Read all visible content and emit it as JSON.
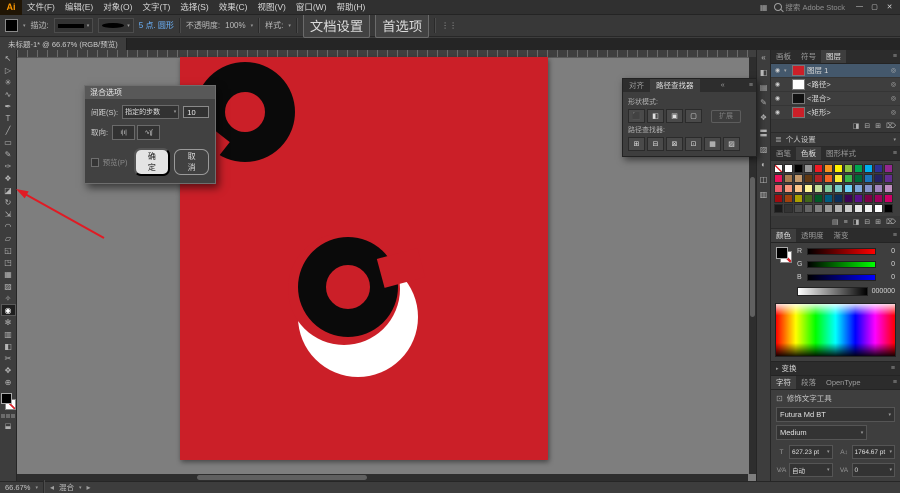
{
  "colors": {
    "artboard_red": "#cb1f28",
    "annotation_red": "#e01b24"
  },
  "menubar": {
    "logo": "Ai",
    "items": [
      "文件(F)",
      "编辑(E)",
      "对象(O)",
      "文字(T)",
      "选择(S)",
      "效果(C)",
      "视图(V)",
      "窗口(W)",
      "帮助(H)"
    ],
    "search_label": "搜索 Adobe Stock",
    "window_controls": [
      {
        "name": "minimize-button",
        "glyph": "—"
      },
      {
        "name": "maximize-button",
        "glyph": "▢"
      },
      {
        "name": "close-button",
        "glyph": "✕"
      }
    ]
  },
  "controlbar": {
    "stroke_label": "描边:",
    "brush_name": "5 点. 圆形",
    "opacity_label": "不透明度:",
    "opacity_value": "100%",
    "style_label": "样式:",
    "doc_setup_button": "文档设置",
    "preferences_button": "首选项"
  },
  "docbar": {
    "tab": "未标题-1* @ 66.67% (RGB/预览)"
  },
  "toolbar": {
    "tools": [
      {
        "name": "selection-tool",
        "glyph": "↖"
      },
      {
        "name": "direct-selection-tool",
        "glyph": "▷"
      },
      {
        "name": "magic-wand-tool",
        "glyph": "✳"
      },
      {
        "name": "lasso-tool",
        "glyph": "∿"
      },
      {
        "name": "pen-tool",
        "glyph": "✒"
      },
      {
        "name": "type-tool",
        "glyph": "T"
      },
      {
        "name": "line-segment-tool",
        "glyph": "╱"
      },
      {
        "name": "rectangle-tool",
        "glyph": "▭"
      },
      {
        "name": "paintbrush-tool",
        "glyph": "✎"
      },
      {
        "name": "pencil-tool",
        "glyph": "✑"
      },
      {
        "name": "shaper-tool",
        "glyph": "❖"
      },
      {
        "name": "eraser-tool",
        "glyph": "◪"
      },
      {
        "name": "rotate-tool",
        "glyph": "↻"
      },
      {
        "name": "scale-tool",
        "glyph": "⇲"
      },
      {
        "name": "width-tool",
        "glyph": "◠"
      },
      {
        "name": "free-transform-tool",
        "glyph": "▱"
      },
      {
        "name": "shape-builder-tool",
        "glyph": "◱"
      },
      {
        "name": "perspective-grid-tool",
        "glyph": "◳"
      },
      {
        "name": "mesh-tool",
        "glyph": "▦"
      },
      {
        "name": "gradient-tool",
        "glyph": "▨"
      },
      {
        "name": "eyedropper-tool",
        "glyph": "✧"
      },
      {
        "name": "blend-tool",
        "glyph": "◉",
        "active": true
      },
      {
        "name": "symbol-sprayer-tool",
        "glyph": "✻"
      },
      {
        "name": "column-graph-tool",
        "glyph": "▥"
      },
      {
        "name": "artboard-tool",
        "glyph": "◧"
      },
      {
        "name": "slice-tool",
        "glyph": "✂"
      },
      {
        "name": "hand-tool",
        "glyph": "✥"
      },
      {
        "name": "zoom-tool",
        "glyph": "⊕"
      }
    ]
  },
  "dialog": {
    "title": "混合选项",
    "spacing_label": "间距(S):",
    "spacing_value": "指定的步数",
    "steps_value": "10",
    "orientation_label": "取向:",
    "orientation_icons": [
      {
        "name": "align-to-page-button",
        "glyph": "ı|ı|"
      },
      {
        "name": "align-to-path-button",
        "glyph": "∿ʅʃ"
      }
    ],
    "preview_label": "预览(P)",
    "ok_label": "确定",
    "cancel_label": "取消"
  },
  "pathfinder_panel": {
    "tabs": [
      {
        "label": "对齐"
      },
      {
        "label": "路径查找器",
        "active": true
      }
    ],
    "shape_modes_label": "形状模式:",
    "shape_mode_icons": [
      {
        "name": "unite-icon",
        "glyph": "⬛"
      },
      {
        "name": "minus-front-icon",
        "glyph": "◧"
      },
      {
        "name": "intersect-icon",
        "glyph": "▣"
      },
      {
        "name": "exclude-icon",
        "glyph": "▢"
      }
    ],
    "expand_button": "扩展",
    "pathfinder_label": "路径查找器:",
    "pathfinder_icons": [
      {
        "name": "divide-icon",
        "glyph": "⊞"
      },
      {
        "name": "trim-icon",
        "glyph": "⊟"
      },
      {
        "name": "merge-icon",
        "glyph": "⊠"
      },
      {
        "name": "crop-icon",
        "glyph": "⊡"
      },
      {
        "name": "outline-icon",
        "glyph": "▦"
      },
      {
        "name": "minus-back-icon",
        "glyph": "▨"
      }
    ]
  },
  "dock_icons": [
    {
      "name": "collapse-panels-icon",
      "glyph": "«"
    },
    {
      "name": "color-panel-icon",
      "glyph": "◧"
    },
    {
      "name": "swatches-panel-icon",
      "glyph": "▤"
    },
    {
      "name": "brushes-panel-icon",
      "glyph": "✎"
    },
    {
      "name": "symbols-panel-icon",
      "glyph": "❖"
    },
    {
      "name": "stroke-panel-icon",
      "glyph": "〓"
    },
    {
      "name": "gradient-panel-icon",
      "glyph": "▨"
    },
    {
      "name": "transparency-panel-icon",
      "glyph": "◐"
    },
    {
      "name": "appearance-panel-icon",
      "glyph": "◫"
    },
    {
      "name": "graphic-styles-panel-icon",
      "glyph": "▥"
    }
  ],
  "layers_panel": {
    "tabs": [
      {
        "label": "画板"
      },
      {
        "label": "符号"
      },
      {
        "label": "图层",
        "active": true
      }
    ],
    "rows": [
      {
        "label": "图层 1",
        "thumb": "#cb1f28",
        "selected": true,
        "expander": "▾"
      },
      {
        "label": "<路径>",
        "thumb": "#ffffff",
        "expander": ""
      },
      {
        "label": "<混合>",
        "thumb": "#111111",
        "expander": ""
      },
      {
        "label": "<矩形>",
        "thumb": "#cb1f28",
        "expander": ""
      }
    ],
    "footer_icons": [
      {
        "name": "make-mask-icon",
        "glyph": "◨"
      },
      {
        "name": "new-sublayer-icon",
        "glyph": "⊟"
      },
      {
        "name": "new-layer-icon",
        "glyph": "⊞"
      },
      {
        "name": "delete-layer-icon",
        "glyph": "⌦"
      }
    ]
  },
  "library_row": {
    "label": "个人设置"
  },
  "swatches_panel": {
    "tabs": [
      {
        "label": "画笔"
      },
      {
        "label": "色板",
        "active": true
      },
      {
        "label": "图形样式"
      }
    ],
    "swatches": [
      "none",
      "#ffffff",
      "#000000",
      "#959595",
      "#ed1c24",
      "#f7941d",
      "#fff200",
      "#8dc63f",
      "#00a651",
      "#00aeef",
      "#2e3192",
      "#92278f",
      "#ed145b",
      "#a87c4f",
      "#c49a6c",
      "#603913",
      "#b02224",
      "#f26522",
      "#f9ed32",
      "#39b54a",
      "#006838",
      "#1b75bb",
      "#262262",
      "#662d91",
      "#f05a6a",
      "#f7977a",
      "#fdc689",
      "#fff799",
      "#c4df9b",
      "#82ca9c",
      "#7accc8",
      "#6dcff6",
      "#7da7d9",
      "#8493ca",
      "#a186be",
      "#bd8cbf",
      "#9e0b0f",
      "#a0410d",
      "#aba000",
      "#406618",
      "#005826",
      "#005b7f",
      "#0b2e5a",
      "#3b0256",
      "#5c0f8b",
      "#7b0046",
      "#9e005d",
      "#cc0066",
      "#1a1a1a",
      "#333333",
      "#4d4d4d",
      "#666666",
      "#808080",
      "#999999",
      "#b3b3b3",
      "#cccccc",
      "#e6e6e6",
      "#f2f2f2",
      "#ffffff",
      "#000000"
    ],
    "footer_icons": [
      {
        "name": "swatch-libraries-icon",
        "glyph": "▤"
      },
      {
        "name": "swatch-kinds-icon",
        "glyph": "≡"
      },
      {
        "name": "swatch-options-icon",
        "glyph": "◨"
      },
      {
        "name": "new-color-group-icon",
        "glyph": "⊟"
      },
      {
        "name": "new-swatch-icon",
        "glyph": "⊞"
      },
      {
        "name": "delete-swatch-icon",
        "glyph": "⌦"
      }
    ]
  },
  "color_panel": {
    "tabs": [
      {
        "label": "颜色",
        "active": true
      },
      {
        "label": "透明度"
      },
      {
        "label": "渐变"
      }
    ],
    "channels": [
      {
        "label": "R",
        "value": "0",
        "bar": "linear-gradient(to right,#000,#f00)"
      },
      {
        "label": "G",
        "value": "0",
        "bar": "linear-gradient(to right,#000,#0f0)"
      },
      {
        "label": "B",
        "value": "0",
        "bar": "linear-gradient(to right,#000,#00f)"
      }
    ],
    "hex_value": "000000"
  },
  "transform_panel": {
    "title": "变换"
  },
  "character_panel": {
    "tabs": [
      {
        "label": "字符",
        "active": true
      },
      {
        "label": "段落"
      },
      {
        "label": "OpenType"
      }
    ],
    "touch_tool": "修饰文字工具",
    "font_name": "Futura Md BT",
    "font_style": "Medium",
    "metrics": [
      {
        "name": "font-size-field",
        "icon": "T",
        "value": "627.23 pt"
      },
      {
        "name": "leading-field",
        "icon": "A↕",
        "value": "1764.67 pt"
      },
      {
        "name": "kerning-field",
        "icon": "V⁄A",
        "value": "自动"
      },
      {
        "name": "tracking-field",
        "icon": "VA",
        "value": "0"
      }
    ]
  },
  "statusbar": {
    "zoom": "66.67%",
    "tool_name": "混合"
  }
}
